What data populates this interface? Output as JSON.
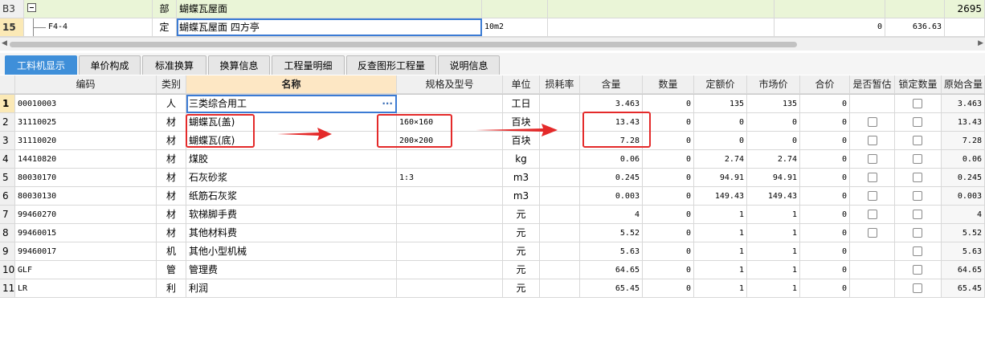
{
  "top_rows": [
    {
      "rownum": "B3",
      "code": "",
      "type": "部",
      "name": "蝴蝶瓦屋面",
      "unit": "",
      "qty": "",
      "price": "",
      "total": "2695"
    },
    {
      "rownum": "15",
      "code": "F4-4",
      "type": "定",
      "name": "蝴蝶瓦屋面 四方亭",
      "unit": "10m2",
      "qty": "0",
      "price": "636.63",
      "total": ""
    }
  ],
  "tabs": [
    "工料机显示",
    "单价构成",
    "标准换算",
    "换算信息",
    "工程量明细",
    "反查图形工程量",
    "说明信息"
  ],
  "columns": [
    "编码",
    "类别",
    "名称",
    "规格及型号",
    "单位",
    "损耗率",
    "含量",
    "数量",
    "定额价",
    "市场价",
    "合价",
    "是否暂估",
    "锁定数量",
    "原始含量"
  ],
  "rows": [
    {
      "no": "1",
      "code": "00010003",
      "cat": "人",
      "name": "三类综合用工",
      "spec": "",
      "unit": "工日",
      "loss": "",
      "content": "3.463",
      "qty": "0",
      "quota": "135",
      "market": "135",
      "sum": "0",
      "orig": "3.463"
    },
    {
      "no": "2",
      "code": "31110025",
      "cat": "材",
      "name": "蝴蝶瓦(盖)",
      "spec": "160×160",
      "unit": "百块",
      "loss": "",
      "content": "13.43",
      "qty": "0",
      "quota": "0",
      "market": "0",
      "sum": "0",
      "orig": "13.43"
    },
    {
      "no": "3",
      "code": "31110020",
      "cat": "材",
      "name": "蝴蝶瓦(底)",
      "spec": "200×200",
      "unit": "百块",
      "loss": "",
      "content": "7.28",
      "qty": "0",
      "quota": "0",
      "market": "0",
      "sum": "0",
      "orig": "7.28"
    },
    {
      "no": "4",
      "code": "14410820",
      "cat": "材",
      "name": "煤胶",
      "spec": "",
      "unit": "kg",
      "loss": "",
      "content": "0.06",
      "qty": "0",
      "quota": "2.74",
      "market": "2.74",
      "sum": "0",
      "orig": "0.06"
    },
    {
      "no": "5",
      "code": "80030170",
      "cat": "材",
      "name": "石灰砂浆",
      "spec": "1:3",
      "unit": "m3",
      "loss": "",
      "content": "0.245",
      "qty": "0",
      "quota": "94.91",
      "market": "94.91",
      "sum": "0",
      "orig": "0.245"
    },
    {
      "no": "6",
      "code": "80030130",
      "cat": "材",
      "name": "纸筋石灰浆",
      "spec": "",
      "unit": "m3",
      "loss": "",
      "content": "0.003",
      "qty": "0",
      "quota": "149.43",
      "market": "149.43",
      "sum": "0",
      "orig": "0.003"
    },
    {
      "no": "7",
      "code": "99460270",
      "cat": "材",
      "name": "软梯脚手费",
      "spec": "",
      "unit": "元",
      "loss": "",
      "content": "4",
      "qty": "0",
      "quota": "1",
      "market": "1",
      "sum": "0",
      "orig": "4"
    },
    {
      "no": "8",
      "code": "99460015",
      "cat": "材",
      "name": "其他材料费",
      "spec": "",
      "unit": "元",
      "loss": "",
      "content": "5.52",
      "qty": "0",
      "quota": "1",
      "market": "1",
      "sum": "0",
      "orig": "5.52"
    },
    {
      "no": "9",
      "code": "99460017",
      "cat": "机",
      "name": "其他小型机械",
      "spec": "",
      "unit": "元",
      "loss": "",
      "content": "5.63",
      "qty": "0",
      "quota": "1",
      "market": "1",
      "sum": "0",
      "orig": "5.63"
    },
    {
      "no": "10",
      "code": "GLF",
      "cat": "管",
      "name": "管理费",
      "spec": "",
      "unit": "元",
      "loss": "",
      "content": "64.65",
      "qty": "0",
      "quota": "1",
      "market": "1",
      "sum": "0",
      "orig": "64.65"
    },
    {
      "no": "11",
      "code": "LR",
      "cat": "利",
      "name": "利润",
      "spec": "",
      "unit": "元",
      "loss": "",
      "content": "65.45",
      "qty": "0",
      "quota": "1",
      "market": "1",
      "sum": "0",
      "orig": "65.45"
    }
  ],
  "ellipsis": "···",
  "annotation_color": "#e42a2a",
  "active_tab_color": "#3f8fd9"
}
